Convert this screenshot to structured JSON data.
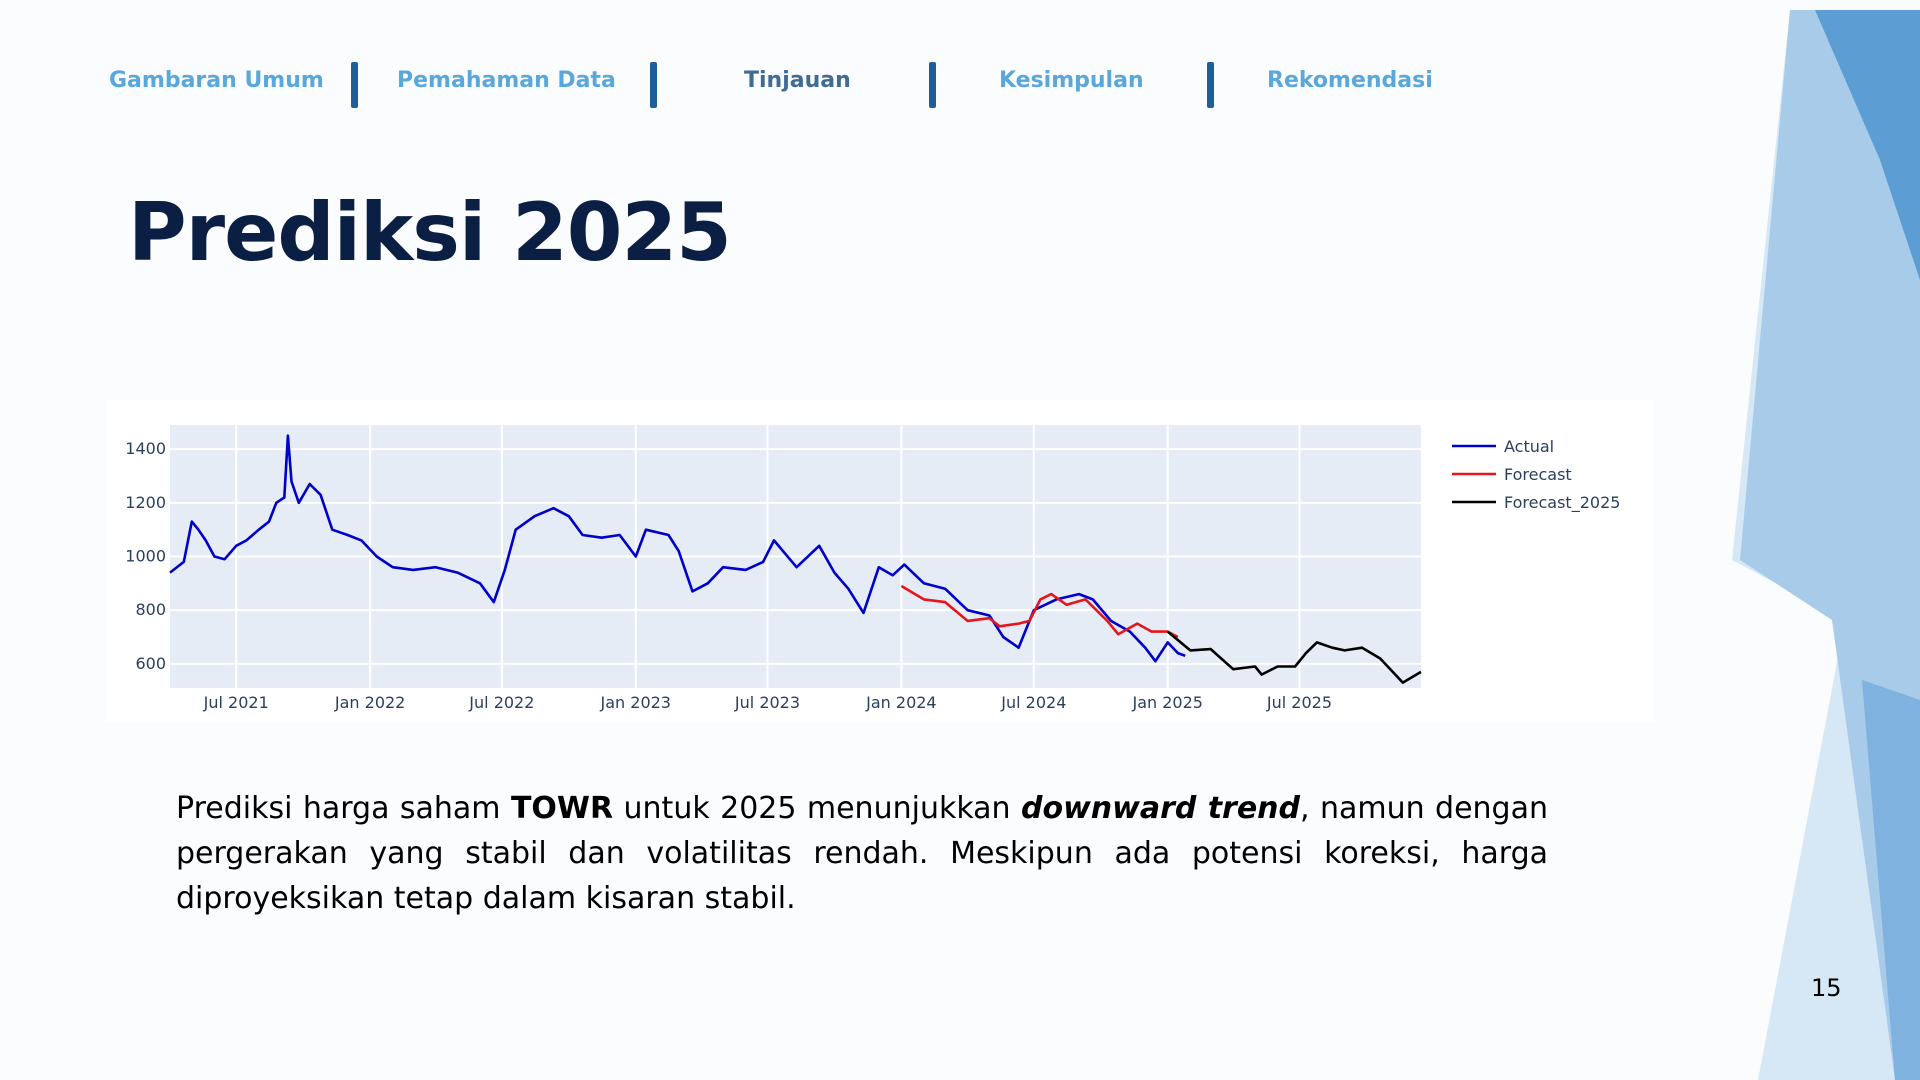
{
  "nav": {
    "items": [
      {
        "label": "Gambaran Umum",
        "active": false
      },
      {
        "label": "Pemahaman Data",
        "active": false
      },
      {
        "label": "Tinjauan",
        "active": true
      },
      {
        "label": "Kesimpulan",
        "active": false
      },
      {
        "label": "Rekomendasi",
        "active": false
      }
    ]
  },
  "title": "Prediksi 2025",
  "description": {
    "p1": "Prediksi harga saham ",
    "ticker": "TOWR",
    "p2": " untuk 2025 menunjukkan ",
    "trend": "downward trend",
    "p3": ", namun dengan pergerakan yang stabil dan volatilitas rendah. Meskipun ada potensi koreksi, harga diproyeksikan tetap dalam kisaran stabil."
  },
  "page_number": "15",
  "colors": {
    "accent_dark": "#0b1f44",
    "nav_link": "#5aa7db",
    "nav_active": "#3f6b95",
    "separator": "#1f5f99"
  },
  "chart_data": {
    "type": "line",
    "title": "",
    "xlabel": "",
    "ylabel": "",
    "x_ticks": [
      "Jul 2021",
      "Jan 2022",
      "Jul 2022",
      "Jan 2023",
      "Jul 2023",
      "Jan 2024",
      "Jul 2024",
      "Jan 2025",
      "Jul 2025"
    ],
    "y_ticks": [
      600,
      800,
      1000,
      1200,
      1400
    ],
    "xlim": [
      "2021-04-01",
      "2025-12-15"
    ],
    "ylim": [
      510,
      1490
    ],
    "grid": true,
    "legend_position": "right",
    "series": [
      {
        "name": "Actual",
        "color": "#0000cc",
        "points": [
          [
            "2021-04-01",
            940
          ],
          [
            "2021-04-20",
            980
          ],
          [
            "2021-05-01",
            1130
          ],
          [
            "2021-05-10",
            1100
          ],
          [
            "2021-05-20",
            1060
          ],
          [
            "2021-06-01",
            1000
          ],
          [
            "2021-06-15",
            990
          ],
          [
            "2021-07-01",
            1040
          ],
          [
            "2021-07-15",
            1060
          ],
          [
            "2021-08-01",
            1100
          ],
          [
            "2021-08-15",
            1130
          ],
          [
            "2021-08-25",
            1200
          ],
          [
            "2021-09-05",
            1220
          ],
          [
            "2021-09-10",
            1450
          ],
          [
            "2021-09-15",
            1280
          ],
          [
            "2021-09-25",
            1200
          ],
          [
            "2021-10-10",
            1270
          ],
          [
            "2021-10-25",
            1230
          ],
          [
            "2021-11-10",
            1100
          ],
          [
            "2021-12-01",
            1080
          ],
          [
            "2021-12-20",
            1060
          ],
          [
            "2022-01-10",
            1000
          ],
          [
            "2022-02-01",
            960
          ],
          [
            "2022-03-01",
            950
          ],
          [
            "2022-04-01",
            960
          ],
          [
            "2022-05-01",
            940
          ],
          [
            "2022-06-01",
            900
          ],
          [
            "2022-06-20",
            830
          ],
          [
            "2022-07-05",
            950
          ],
          [
            "2022-07-20",
            1100
          ],
          [
            "2022-08-15",
            1150
          ],
          [
            "2022-09-10",
            1180
          ],
          [
            "2022-10-01",
            1150
          ],
          [
            "2022-10-20",
            1080
          ],
          [
            "2022-11-15",
            1070
          ],
          [
            "2022-12-10",
            1080
          ],
          [
            "2023-01-01",
            1000
          ],
          [
            "2023-01-15",
            1100
          ],
          [
            "2023-02-15",
            1080
          ],
          [
            "2023-03-01",
            1020
          ],
          [
            "2023-03-20",
            870
          ],
          [
            "2023-04-10",
            900
          ],
          [
            "2023-05-01",
            960
          ],
          [
            "2023-06-01",
            950
          ],
          [
            "2023-06-25",
            980
          ],
          [
            "2023-07-10",
            1060
          ],
          [
            "2023-08-10",
            960
          ],
          [
            "2023-09-10",
            1040
          ],
          [
            "2023-10-01",
            940
          ],
          [
            "2023-10-20",
            880
          ],
          [
            "2023-11-10",
            790
          ],
          [
            "2023-12-01",
            960
          ],
          [
            "2023-12-20",
            930
          ],
          [
            "2024-01-05",
            970
          ],
          [
            "2024-02-01",
            900
          ],
          [
            "2024-03-01",
            880
          ],
          [
            "2024-04-01",
            800
          ],
          [
            "2024-05-01",
            780
          ],
          [
            "2024-05-20",
            700
          ],
          [
            "2024-06-10",
            660
          ],
          [
            "2024-07-01",
            800
          ],
          [
            "2024-08-01",
            840
          ],
          [
            "2024-09-01",
            860
          ],
          [
            "2024-09-20",
            840
          ],
          [
            "2024-10-15",
            760
          ],
          [
            "2024-11-10",
            720
          ],
          [
            "2024-12-01",
            660
          ],
          [
            "2024-12-15",
            610
          ],
          [
            "2025-01-01",
            680
          ],
          [
            "2025-01-15",
            640
          ],
          [
            "2025-01-25",
            630
          ]
        ]
      },
      {
        "name": "Forecast",
        "color": "#e8141c",
        "points": [
          [
            "2024-01-01",
            890
          ],
          [
            "2024-02-01",
            840
          ],
          [
            "2024-03-01",
            830
          ],
          [
            "2024-04-01",
            760
          ],
          [
            "2024-05-01",
            770
          ],
          [
            "2024-05-15",
            740
          ],
          [
            "2024-06-10",
            750
          ],
          [
            "2024-06-25",
            760
          ],
          [
            "2024-07-10",
            840
          ],
          [
            "2024-07-25",
            860
          ],
          [
            "2024-08-15",
            820
          ],
          [
            "2024-09-10",
            840
          ],
          [
            "2024-10-10",
            760
          ],
          [
            "2024-10-25",
            710
          ],
          [
            "2024-11-20",
            750
          ],
          [
            "2024-12-10",
            720
          ],
          [
            "2025-01-01",
            720
          ],
          [
            "2025-01-15",
            700
          ]
        ]
      },
      {
        "name": "Forecast_2025",
        "color": "#000000",
        "points": [
          [
            "2025-01-01",
            720
          ],
          [
            "2025-02-01",
            650
          ],
          [
            "2025-03-01",
            655
          ],
          [
            "2025-04-01",
            580
          ],
          [
            "2025-05-01",
            590
          ],
          [
            "2025-05-10",
            560
          ],
          [
            "2025-06-01",
            590
          ],
          [
            "2025-06-25",
            590
          ],
          [
            "2025-07-10",
            640
          ],
          [
            "2025-07-25",
            680
          ],
          [
            "2025-08-15",
            660
          ],
          [
            "2025-09-01",
            650
          ],
          [
            "2025-09-25",
            660
          ],
          [
            "2025-10-20",
            620
          ],
          [
            "2025-11-20",
            530
          ],
          [
            "2025-12-15",
            570
          ]
        ]
      }
    ]
  }
}
